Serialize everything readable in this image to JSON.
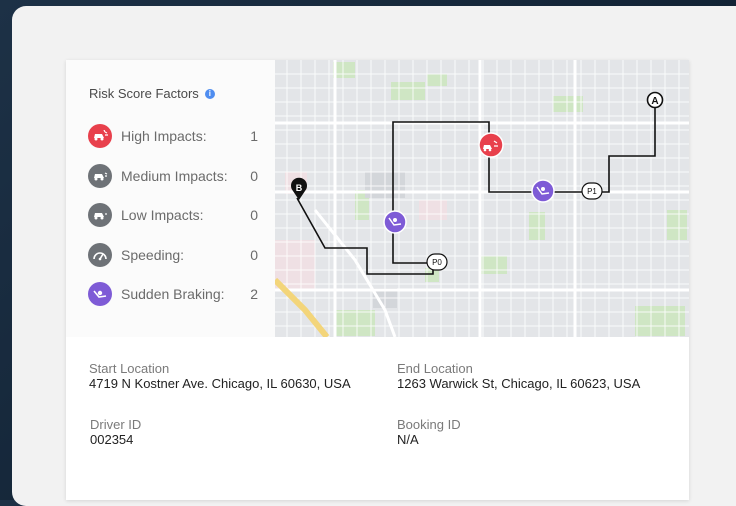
{
  "risk_factors": {
    "title": "Risk Score Factors",
    "items": [
      {
        "label": "High Impacts:",
        "count": "1",
        "color": "#e8404c",
        "icon": "high-impact-icon"
      },
      {
        "label": "Medium Impacts:",
        "count": "0",
        "color": "#6e7277",
        "icon": "medium-impact-icon"
      },
      {
        "label": "Low Impacts:",
        "count": "0",
        "color": "#6e7277",
        "icon": "low-impact-icon"
      },
      {
        "label": "Speeding:",
        "count": "0",
        "color": "#6e7277",
        "icon": "speeding-icon"
      },
      {
        "label": "Sudden Braking:",
        "count": "2",
        "color": "#7e5bd6",
        "icon": "sudden-braking-icon"
      }
    ]
  },
  "map": {
    "start_marker": "A",
    "end_marker": "B",
    "poi_markers": [
      "P0",
      "P1"
    ],
    "route_color": "#111111"
  },
  "details": {
    "start_location": {
      "label": "Start Location",
      "value": "4719 N Kostner Ave. Chicago, IL 60630, USA"
    },
    "end_location": {
      "label": "End Location",
      "value": "1263 Warwick St, Chicago, IL 60623, USA"
    },
    "driver_id": {
      "label": "Driver ID",
      "value": "002354"
    },
    "booking_id": {
      "label": "Booking ID",
      "value": "N/A"
    }
  }
}
